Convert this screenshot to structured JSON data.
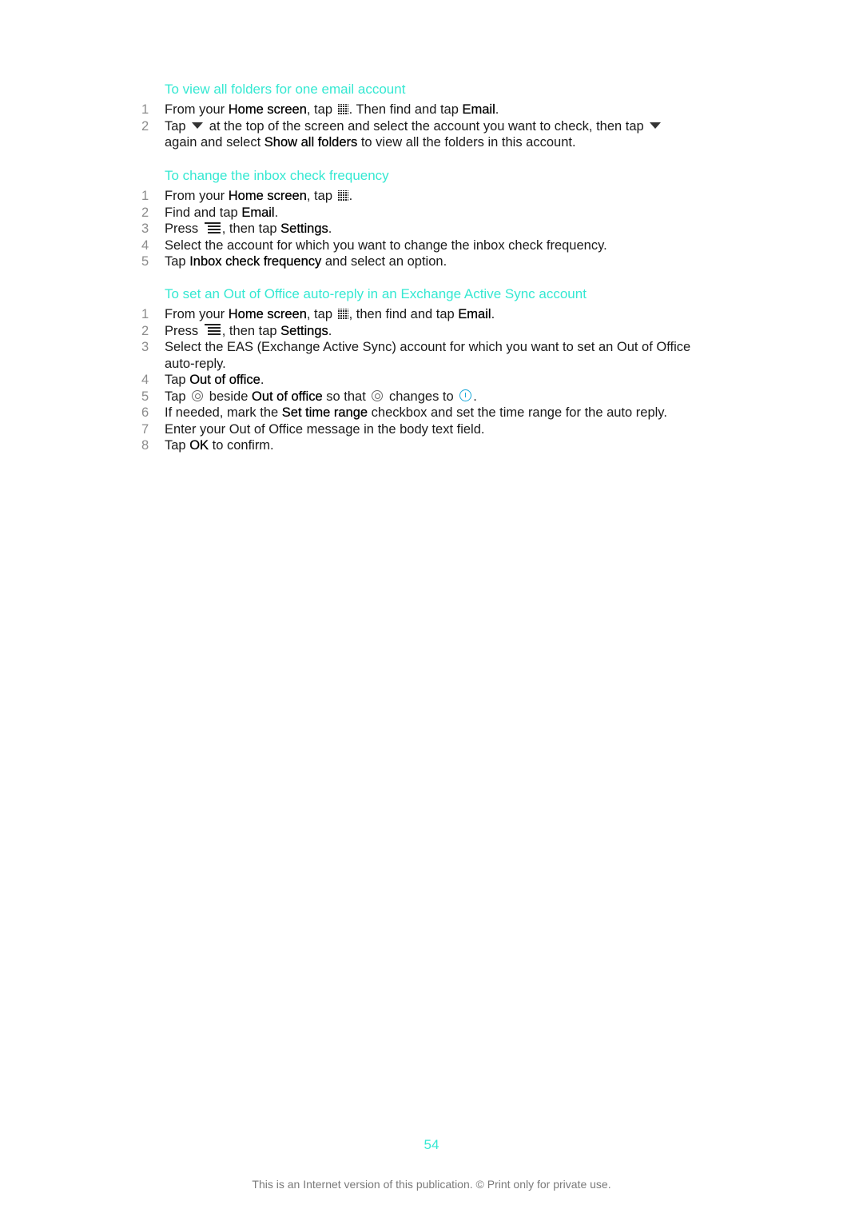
{
  "sections": [
    {
      "heading": "To view all folders for one email account",
      "steps": [
        {
          "num": "1",
          "parts": [
            "From your ",
            "Home screen",
            ", tap ",
            "",
            ". Then find and tap ",
            "Email",
            "."
          ]
        },
        {
          "num": "2",
          "parts": [
            "Tap ",
            "",
            " at the top of the screen and select the account you want to check, then tap ",
            "",
            " again and select ",
            "Show all folders",
            " to view all the folders in this account."
          ]
        }
      ]
    },
    {
      "heading": "To change the inbox check frequency",
      "steps": [
        {
          "num": "1",
          "parts": [
            "From your ",
            "Home screen",
            ", tap ",
            "",
            "."
          ]
        },
        {
          "num": "2",
          "parts": [
            "Find and tap ",
            "Email",
            "."
          ]
        },
        {
          "num": "3",
          "parts": [
            "Press ",
            "",
            ", then tap ",
            "Settings",
            "."
          ]
        },
        {
          "num": "4",
          "parts": [
            "Select the account for which you want to change the inbox check frequency."
          ]
        },
        {
          "num": "5",
          "parts": [
            "Tap ",
            "Inbox check frequency",
            " and select an option."
          ]
        }
      ]
    },
    {
      "heading": "To set an Out of Office auto-reply in an Exchange Active Sync account",
      "steps": [
        {
          "num": "1",
          "parts": [
            "From your ",
            "Home screen",
            ", tap ",
            "",
            ", then find and tap ",
            "Email",
            "."
          ]
        },
        {
          "num": "2",
          "parts": [
            "Press ",
            "",
            ", then tap ",
            "Settings",
            "."
          ]
        },
        {
          "num": "3",
          "parts": [
            "Select the EAS (Exchange Active Sync) account for which you want to set an Out of Office auto-reply."
          ]
        },
        {
          "num": "4",
          "parts": [
            "Tap ",
            "Out of office",
            "."
          ]
        },
        {
          "num": "5",
          "parts": [
            "Tap ",
            "",
            " beside ",
            "Out of office",
            " so that ",
            "",
            " changes to ",
            "",
            "."
          ]
        },
        {
          "num": "6",
          "parts": [
            "If needed, mark the ",
            "Set time range",
            " checkbox and set the time range for the auto reply."
          ]
        },
        {
          "num": "7",
          "parts": [
            "Enter your Out of Office message in the body text field."
          ]
        },
        {
          "num": "8",
          "parts": [
            "Tap ",
            "OK",
            " to confirm."
          ]
        }
      ]
    }
  ],
  "icons": {
    "apps": "app-grid-icon",
    "dropdown": "dropdown-triangle-icon",
    "menu": "menu-icon",
    "toggle_off": "toggle-off-icon",
    "toggle_on": "toggle-on-icon"
  },
  "colors": {
    "heading": "#35e8d2",
    "step_number": "#8c8c8c",
    "toggle_on": "#1aa7d8"
  },
  "page_number": "54",
  "footer": "This is an Internet version of this publication. © Print only for private use."
}
